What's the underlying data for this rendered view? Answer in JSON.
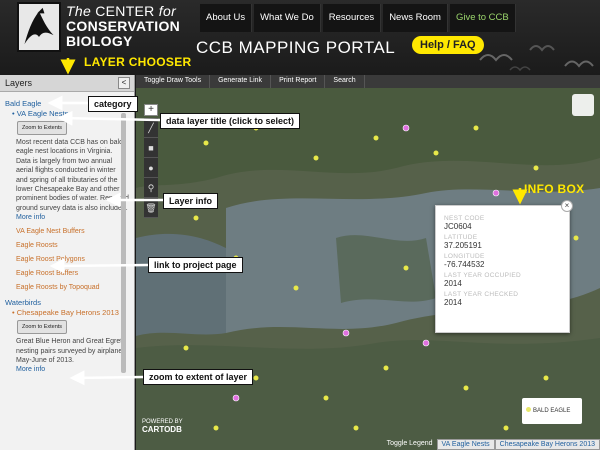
{
  "header": {
    "org_line1_the": "The",
    "org_line1_rest": "CENTER",
    "org_line1_for": "for",
    "org_line2": "CONSERVATION",
    "org_line3": "BIOLOGY",
    "nav": [
      "About Us",
      "What We Do",
      "Resources",
      "News Room",
      "Give to CCB"
    ],
    "portal_title": "CCB MAPPING PORTAL",
    "help": "Help / FAQ"
  },
  "annotations": {
    "layer_chooser": "LAYER CHOOSER",
    "info_box": "INFO BOX",
    "category": "category",
    "data_layer_title": "data layer title (click to select)",
    "layer_info": "Layer info",
    "link_to_project": "link to project page",
    "zoom_to_extent": "zoom to extent of layer"
  },
  "panel": {
    "title": "Layers",
    "collapse": "<",
    "cat1": "Bald Eagle",
    "layer1": "VA Eagle Nests",
    "zoom": "Zoom to Extents",
    "info1": "Most recent data CCB has on bald eagle nest locations in Virginia. Data is largely from two annual aerial flights conducted in winter and spring of all tributaries of the lower Chesapeake Bay and other prominent bodies of water. Reported ground survey data is also included.",
    "more": "More info",
    "layers_more": [
      "VA Eagle Nest Buffers",
      "Eagle Roosts",
      "Eagle Roost Polygons",
      "Eagle Roost Buffers",
      "Eagle Roosts by Topoquad"
    ],
    "cat2": "Waterbirds",
    "layer2": "Chesapeake Bay Herons 2013",
    "info2": "Great Blue Heron and Great Egret nesting pairs surveyed by airplane May-June of 2013.",
    "more2": "More info"
  },
  "toolbar": [
    "Toggle Draw Tools",
    "Generate Link",
    "Print Report",
    "Search"
  ],
  "infobox": {
    "fields": [
      {
        "label": "NEST CODE",
        "value": "JC0604"
      },
      {
        "label": "LATITUDE",
        "value": "37.205191"
      },
      {
        "label": "LONGITUDE",
        "value": "-76.744532"
      },
      {
        "label": "LAST YEAR OCCUPIED",
        "value": "2014"
      },
      {
        "label": "LAST YEAR CHECKED",
        "value": "2014"
      }
    ],
    "close": "×"
  },
  "legend": {
    "label": "BALD EAGLE",
    "dot_color": "#e8e86a"
  },
  "map": {
    "powered_by": "POWERED BY",
    "cartodb": "CARTODB",
    "bottom_tabs": [
      "Toggle Legend",
      "VA Eagle Nests",
      "Chesapeake Bay Herons 2013"
    ]
  },
  "colors": {
    "accent_yellow": "#ffe800",
    "link_blue": "#1f5f9e",
    "orange": "#c8702a"
  }
}
